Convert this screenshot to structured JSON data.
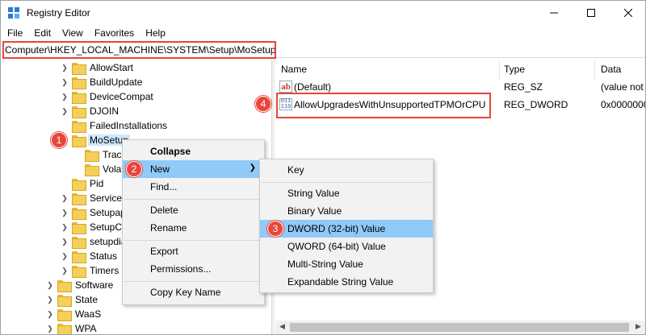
{
  "window": {
    "title": "Registry Editor"
  },
  "menubar": [
    "File",
    "Edit",
    "View",
    "Favorites",
    "Help"
  ],
  "address": {
    "path": "Computer\\HKEY_LOCAL_MACHINE\\SYSTEM\\Setup\\MoSetup"
  },
  "tree": {
    "items": [
      {
        "label": "AllowStart"
      },
      {
        "label": "BuildUpdate"
      },
      {
        "label": "DeviceCompat"
      },
      {
        "label": "DJOIN"
      },
      {
        "label": "FailedInstallations"
      },
      {
        "label": "MoSetup"
      },
      {
        "label": "Track"
      },
      {
        "label": "Volati"
      },
      {
        "label": "Pid"
      },
      {
        "label": "Service F"
      },
      {
        "label": "Setupap"
      },
      {
        "label": "SetupCI"
      },
      {
        "label": "setupdia"
      },
      {
        "label": "Status"
      },
      {
        "label": "Timers"
      },
      {
        "label": "Software"
      },
      {
        "label": "State"
      },
      {
        "label": "WaaS"
      },
      {
        "label": "WPA"
      }
    ]
  },
  "columns": {
    "name": "Name",
    "type": "Type",
    "data": "Data"
  },
  "values": [
    {
      "name": "(Default)",
      "type": "REG_SZ",
      "data": "(value not",
      "icon": "string-value-icon"
    },
    {
      "name": "AllowUpgradesWithUnsupportedTPMOrCPU",
      "type": "REG_DWORD",
      "data": "0x0000000",
      "icon": "binary-value-icon"
    }
  ],
  "context_menu": {
    "items": [
      "Collapse",
      "New",
      "Find...",
      "Delete",
      "Rename",
      "Export",
      "Permissions...",
      "Copy Key Name"
    ]
  },
  "new_submenu": {
    "items": [
      "Key",
      "String Value",
      "Binary Value",
      "DWORD (32-bit) Value",
      "QWORD (64-bit) Value",
      "Multi-String Value",
      "Expandable String Value"
    ]
  },
  "steps": [
    "1",
    "2",
    "3",
    "4"
  ],
  "colors": {
    "annotation": "#e8453c",
    "highlight": "#91c9f7",
    "selection": "#cce8ff",
    "folder": "#f5cf5a"
  }
}
